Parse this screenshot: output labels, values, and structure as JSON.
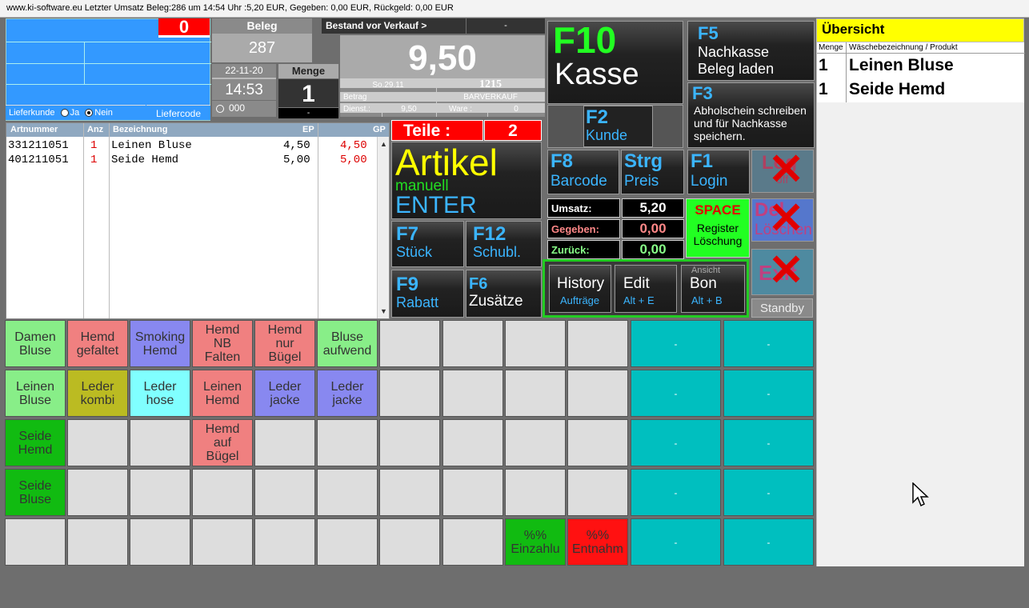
{
  "titlebar": {
    "text": "www.ki-software.eu  Letzter Umsatz Beleg:286 um  14:54 Uhr :5,20 EUR, Gegeben: 0,00 EUR, Rückgeld: 0,00 EUR"
  },
  "customer": {
    "counter": "0",
    "lieferkunde_label": "Lieferkunde",
    "ja_label": "Ja",
    "nein_label": "Nein",
    "liefercode_label": "Liefercode"
  },
  "beleg": {
    "label": "Beleg",
    "number": "287",
    "date": "22-11-20",
    "time": "14:53",
    "counter": "000"
  },
  "menge": {
    "label": "Menge",
    "value": "1",
    "sub": "-"
  },
  "bestand": {
    "label": "Bestand vor Verkauf >",
    "value": "-",
    "big": "9,50"
  },
  "info": {
    "day": "So.29.11",
    "code": "1215",
    "betrag_label": "Betrag",
    "verkauf": "BARVERKAUF",
    "dienst_label": "Dienst.:",
    "dienst_value": "9,50",
    "ware_label": "Ware :",
    "ware_value": "0"
  },
  "list": {
    "headers": {
      "artnr": "Artnummer",
      "anz": "Anz",
      "bez": "Bezeichnung",
      "ep": "EP",
      "gp": "GP"
    },
    "rows": [
      {
        "artnr": "331211051",
        "anz": "1",
        "bez": "Leinen Bluse",
        "ep": "4,50",
        "gp": "4,50"
      },
      {
        "artnr": "401211051",
        "anz": "1",
        "bez": "Seide Hemd",
        "ep": "5,00",
        "gp": "5,00"
      }
    ]
  },
  "teile": {
    "label": "Teile :",
    "value": "2"
  },
  "artikel": {
    "title": "Artikel",
    "line2": "manuell",
    "line3": "ENTER"
  },
  "keys": {
    "f7": {
      "key": "F7",
      "label": "Stück"
    },
    "f12": {
      "key": "F12",
      "label": "Schubl."
    },
    "f9": {
      "key": "F9",
      "label": "Rabatt"
    },
    "f6": {
      "key": "F6",
      "label": "Zusätze"
    },
    "f10": {
      "key": "F10",
      "label": "Kasse"
    },
    "f5": {
      "key": "F5",
      "line1": "Nachkasse",
      "line2": "Beleg laden"
    },
    "f3": {
      "key": "F3",
      "line1": "Abholschein schreiben",
      "line2": "und für Nachkasse",
      "line3": "speichern."
    },
    "f2": {
      "key": "F2",
      "label": "Kunde"
    },
    "f8": {
      "key": "F8",
      "label": "Barcode"
    },
    "strg": {
      "key": "Strg",
      "label": "Preis"
    },
    "f1": {
      "key": "F1",
      "label": "Login"
    },
    "logout": {
      "line1": "Log",
      "line2": "off"
    },
    "del": {
      "line1": "Del",
      "line2": "Löschen"
    },
    "exit": {
      "line1": "Exit"
    }
  },
  "totals": {
    "umsatz_label": "Umsatz:",
    "umsatz": "5,20",
    "gegeben_label": "Gegeben:",
    "gegeben": "0,00",
    "zurueck_label": "Zurück:",
    "zurueck": "0,00"
  },
  "space": {
    "key": "SPACE",
    "line1": "Register",
    "line2": "Löschung"
  },
  "history": {
    "label": "History",
    "sub": "Aufträge"
  },
  "edit": {
    "label": "Edit",
    "sub": "Alt + E"
  },
  "bon": {
    "top": "Ansicht",
    "label": "Bon",
    "sub": "Alt + B"
  },
  "standby": "Standby",
  "uebersicht": {
    "title": "Übersicht",
    "col_menge": "Menge",
    "col_produkt": "Wäschebezeichnung / Produkt",
    "rows": [
      {
        "menge": "1",
        "produkt": "Leinen Bluse"
      },
      {
        "menge": "1",
        "produkt": "Seide Hemd"
      }
    ]
  },
  "products": [
    {
      "text": "Damen\nBluse",
      "color": "#88ee88"
    },
    {
      "text": "Hemd\ngefaltet",
      "color": "#f08080"
    },
    {
      "text": "Smoking\nHemd",
      "color": "#8888f0"
    },
    {
      "text": "Hemd\nNB\nFalten",
      "color": "#f08080"
    },
    {
      "text": "Hemd\nnur\nBügel",
      "color": "#f08080"
    },
    {
      "text": "Bluse\naufwend",
      "color": "#88ee88"
    },
    {
      "text": "Leinen\nBluse",
      "color": "#88ee88"
    },
    {
      "text": "Leder\nkombi",
      "color": "#bbbb22"
    },
    {
      "text": "Leder\nhose",
      "color": "#80ffff"
    },
    {
      "text": "Leinen\nHemd",
      "color": "#f08080"
    },
    {
      "text": "Leder\njacke",
      "color": "#8888f0"
    },
    {
      "text": "Leder\njacke",
      "color": "#8888f0"
    },
    {
      "text": "Seide\nHemd",
      "color": "#11bb11"
    },
    {
      "text": "Hemd\nauf\nBügel",
      "color": "#f08080"
    },
    {
      "text": "Seide\nBluse",
      "color": "#11bb11"
    },
    {
      "text": "%%\nEinzahlu",
      "color": "#11bb11"
    },
    {
      "text": "%%\nEntnahm",
      "color": "#ff1111"
    }
  ],
  "teal_label": "-"
}
